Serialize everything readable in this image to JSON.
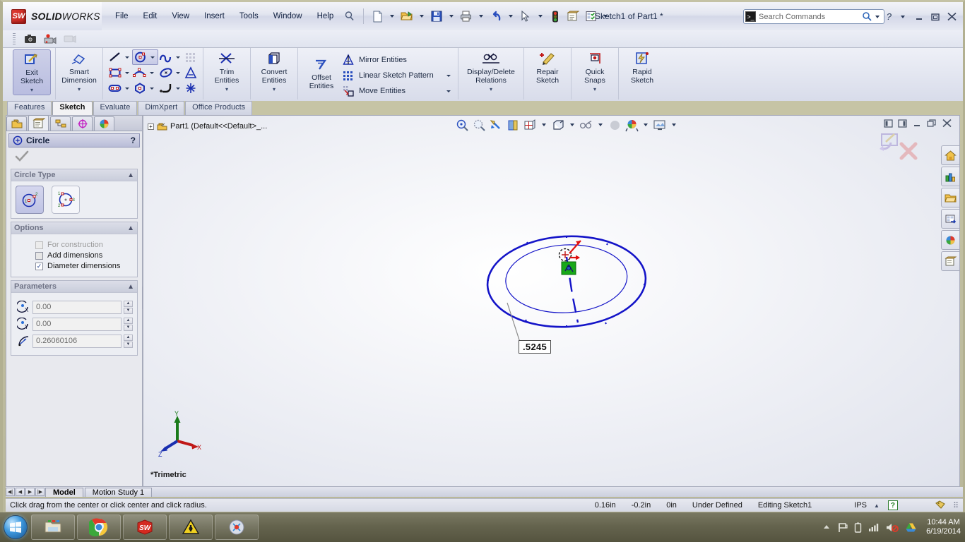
{
  "window": {
    "app_name_bold": "SOLID",
    "app_name_rest": "WORKS",
    "doc_title": "Sketch1 of Part1 *",
    "logo_text": "SW"
  },
  "menu": {
    "items": [
      "File",
      "Edit",
      "View",
      "Insert",
      "Tools",
      "Window",
      "Help"
    ]
  },
  "quick_access": {
    "icons": [
      "new-document-icon",
      "open-folder-icon",
      "save-icon",
      "print-icon",
      "undo-icon",
      "select-arrow-icon",
      "rebuild-icon",
      "options-icon",
      "customize-icon"
    ]
  },
  "search": {
    "placeholder": "Search Commands",
    "icon": "command-search-icon"
  },
  "window_controls": {
    "help": "?",
    "minimize": "minimize-icon",
    "restore": "restore-icon",
    "close": "close-icon"
  },
  "toolbar2": {
    "icons": [
      "screen-capture-icon",
      "record-video-icon",
      "stop-record-icon"
    ]
  },
  "ribbon": {
    "groups": [
      {
        "name": "exit-sketch",
        "buttons": [
          {
            "label_line1": "Exit",
            "label_line2": "Sketch",
            "icon": "exit-sketch-icon",
            "selected": true,
            "dropdown": true
          }
        ]
      },
      {
        "name": "smart-dimension",
        "buttons": [
          {
            "label_line1": "Smart",
            "label_line2": "Dimension",
            "icon": "smart-dimension-icon",
            "selected": false,
            "dropdown": true
          }
        ]
      },
      {
        "name": "sketch-entities",
        "small_icons": [
          [
            "line-icon",
            "rectangle-icon",
            "slot-icon"
          ],
          [
            "circle-icon",
            "arc-icon",
            "polygon-icon"
          ],
          [
            "spline-icon",
            "ellipse-icon",
            "fillet-icon"
          ],
          [
            "sketch-pattern-icon",
            "text-icon",
            "point-icon"
          ]
        ]
      },
      {
        "name": "trim-entities",
        "buttons": [
          {
            "label_line1": "Trim",
            "label_line2": "Entities",
            "icon": "trim-entities-icon",
            "dropdown": true
          }
        ]
      },
      {
        "name": "convert-entities",
        "buttons": [
          {
            "label_line1": "Convert",
            "label_line2": "Entities",
            "icon": "convert-entities-icon",
            "dropdown": true
          }
        ]
      },
      {
        "name": "offset-entities",
        "buttons": [
          {
            "label_line1": "Offset",
            "label_line2": "Entities",
            "icon": "offset-entities-icon",
            "dropdown": false
          }
        ]
      },
      {
        "name": "entity-tools",
        "rows": [
          {
            "label": "Mirror Entities",
            "icon": "mirror-entities-icon",
            "dropdown": false
          },
          {
            "label": "Linear Sketch Pattern",
            "icon": "linear-pattern-icon",
            "dropdown": true
          },
          {
            "label": "Move Entities",
            "icon": "move-entities-icon",
            "dropdown": true
          }
        ]
      },
      {
        "name": "display-delete-relations",
        "buttons": [
          {
            "label_line1": "Display/Delete",
            "label_line2": "Relations",
            "icon": "relations-icon",
            "dropdown": true
          }
        ]
      },
      {
        "name": "repair-sketch",
        "buttons": [
          {
            "label_line1": "Repair",
            "label_line2": "Sketch",
            "icon": "repair-sketch-icon",
            "dropdown": false
          }
        ]
      },
      {
        "name": "quick-snaps",
        "buttons": [
          {
            "label_line1": "Quick",
            "label_line2": "Snaps",
            "icon": "quick-snaps-icon",
            "dropdown": true
          }
        ]
      },
      {
        "name": "rapid-sketch",
        "buttons": [
          {
            "label_line1": "Rapid",
            "label_line2": "Sketch",
            "icon": "rapid-sketch-icon",
            "dropdown": false
          }
        ]
      }
    ]
  },
  "tabs": {
    "items": [
      {
        "label": "Features",
        "active": false
      },
      {
        "label": "Sketch",
        "active": true
      },
      {
        "label": "Evaluate",
        "active": false
      },
      {
        "label": "DimXpert",
        "active": false
      },
      {
        "label": "Office Products",
        "active": false
      }
    ]
  },
  "property_manager": {
    "tabs": [
      "feature-manager-tab",
      "property-manager-tab",
      "configuration-manager-tab",
      "dimxpert-manager-tab",
      "display-manager-tab"
    ],
    "header": {
      "title": "Circle",
      "icon": "circle-icon",
      "help": "?"
    },
    "ok_icon": "check-icon",
    "sections": [
      {
        "title": "Circle Type",
        "collapse_icon": "chevron-up-icon",
        "options": [
          {
            "name": "center-circle",
            "selected": true
          },
          {
            "name": "perimeter-circle",
            "selected": false
          }
        ]
      },
      {
        "title": "Options",
        "collapse_icon": "chevron-up-icon",
        "checkboxes": [
          {
            "label": "For construction",
            "checked": false,
            "disabled": true
          },
          {
            "label": "Add dimensions",
            "checked": false,
            "disabled": false
          },
          {
            "label": "Diameter dimensions",
            "checked": true,
            "disabled": false
          }
        ]
      },
      {
        "title": "Parameters",
        "collapse_icon": "chevron-up-icon",
        "fields": [
          {
            "icon": "center-x-icon",
            "value": "0.00"
          },
          {
            "icon": "center-y-icon",
            "value": "0.00"
          },
          {
            "icon": "radius-icon",
            "value": "0.26060106"
          }
        ]
      }
    ]
  },
  "graphics": {
    "feature_tree_root": "Part1 (Default<<Default>_...",
    "view_toolbar_icons": [
      "zoom-to-fit-icon",
      "zoom-to-area-icon",
      "previous-view-icon",
      "section-view-icon",
      "view-orientation-icon",
      "display-style-icon",
      "hide-show-icon",
      "edit-appearance-icon",
      "apply-scene-icon",
      "view-settings-icon"
    ],
    "window_buttons": [
      "restore-left-icon",
      "restore-right-icon",
      "minimize-icon",
      "restore-icon",
      "close-icon"
    ],
    "confirm_corner": [
      "confirm-sketch-icon",
      "cancel-sketch-icon"
    ],
    "task_pane_icons": [
      "design-library-home-icon",
      "design-library-icon",
      "file-explorer-icon",
      "search-icon",
      "view-palette-icon",
      "appearances-icon",
      "custom-properties-icon"
    ],
    "dimension_label": ".5245",
    "view_label": "*Trimetric",
    "triad_axes": [
      "X",
      "Y",
      "Z"
    ],
    "sketch_color": "#1414c8",
    "construction_color": "#3a3ad0"
  },
  "bottom_tabs": {
    "nav_buttons": [
      "first-icon",
      "previous-icon",
      "next-icon",
      "last-icon"
    ],
    "items": [
      {
        "label": "Model",
        "active": true
      },
      {
        "label": "Motion Study 1",
        "active": false
      }
    ]
  },
  "status_bar": {
    "message": "Click drag from the center or click center and click radius.",
    "coord_x": "0.16in",
    "coord_y": "-0.2in",
    "coord_z": "0in",
    "sketch_state": "Under Defined",
    "editing": "Editing Sketch1",
    "units": "IPS",
    "help_badge": "?",
    "tag_icon": "tag-icon"
  },
  "taskbar": {
    "start": "start-orb-icon",
    "apps": [
      "file-explorer-icon",
      "google-chrome-icon",
      "solidworks-icon",
      "warning-app-icon",
      "media-app-icon"
    ],
    "tray_icons": [
      "show-hidden-icons-icon",
      "flag-action-center-icon",
      "battery-icon",
      "network-signal-icon",
      "volume-muted-icon",
      "google-drive-icon"
    ],
    "time": "10:44 AM",
    "date": "6/19/2014"
  }
}
